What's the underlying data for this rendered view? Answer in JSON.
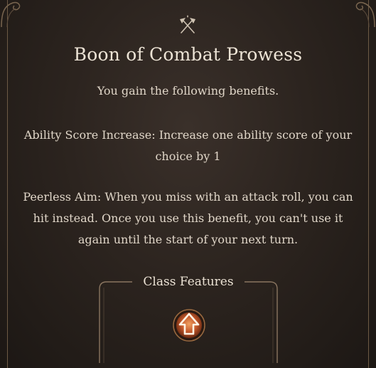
{
  "tooltip": {
    "header_icon": "crossed-axes-icon",
    "title": "Boon of Combat Prowess",
    "subtitle": "You gain the following benefits.",
    "benefits": [
      {
        "text": "Ability Score Increase: Increase one ability score of your choice by 1"
      },
      {
        "text": "Peerless Aim: When you miss with an attack roll, you can hit instead. Once you use this benefit, you can't use it again until the start of your next turn."
      }
    ],
    "class_features": {
      "label": "Class Features",
      "items": [
        {
          "icon": "up-arrow-feature-icon"
        }
      ]
    }
  },
  "colors": {
    "background": "#2c241f",
    "text": "#e0d6c8",
    "frame": "#6d5a45",
    "icon_orange": "#d9743a"
  }
}
